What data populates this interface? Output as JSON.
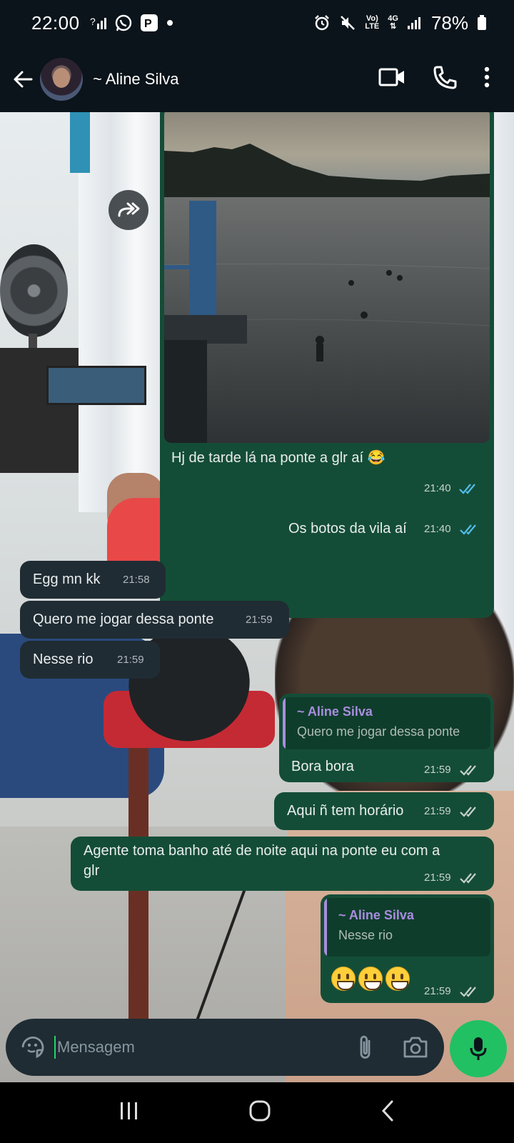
{
  "status_bar": {
    "time": "22:00",
    "battery": "78%",
    "network_top": "Vo)",
    "network_bottom": "LTE",
    "gen": "4G"
  },
  "header": {
    "contact_name": "~ Aline Silva"
  },
  "messages": [
    {
      "id": "m1",
      "direction": "out",
      "type": "image",
      "text": "Hj de tarde lá na ponte a glr aí 😂",
      "time": "21:40",
      "status": "read"
    },
    {
      "id": "m2",
      "direction": "out",
      "text": "Os botos da vila aí",
      "time": "21:40",
      "status": "read"
    },
    {
      "id": "m3",
      "direction": "in",
      "text": "Egg mn kk",
      "time": "21:58"
    },
    {
      "id": "m4",
      "direction": "in",
      "text": "Quero me jogar dessa ponte",
      "time": "21:59"
    },
    {
      "id": "m5",
      "direction": "in",
      "text": "Nesse rio",
      "time": "21:59"
    },
    {
      "id": "m6",
      "direction": "out",
      "reply_to": {
        "name": "~ Aline Silva",
        "text": "Quero me jogar dessa ponte"
      },
      "text": "Bora bora",
      "time": "21:59",
      "status": "delivered"
    },
    {
      "id": "m7",
      "direction": "out",
      "text": "Aqui ñ tem horário",
      "time": "21:59",
      "status": "delivered"
    },
    {
      "id": "m8",
      "direction": "out",
      "text": "Agente toma banho até de noite aqui na ponte eu com a\nglr",
      "time": "21:59",
      "status": "delivered"
    },
    {
      "id": "m9",
      "direction": "out",
      "reply_to": {
        "name": "~ Aline Silva",
        "text": "Nesse rio"
      },
      "emoji_count": 3,
      "emoji": "grinning-face",
      "time": "21:59",
      "status": "delivered"
    }
  ],
  "input": {
    "placeholder": "Mensagem"
  },
  "colors": {
    "outgoing_bubble": "#144d37",
    "incoming_bubble": "#202c33",
    "read_ticks": "#53bdeb",
    "delivered_ticks": "#c8d2cd",
    "mic_button": "#21c063",
    "quote_accent": "#a98dde"
  },
  "icons": {
    "back": "arrow-left-icon",
    "video": "video-call-icon",
    "call": "phone-icon",
    "menu": "more-vert-icon",
    "forward": "forward-icon",
    "sticker": "sticker-icon",
    "attach": "paperclip-icon",
    "camera": "camera-icon",
    "mic": "mic-icon"
  }
}
